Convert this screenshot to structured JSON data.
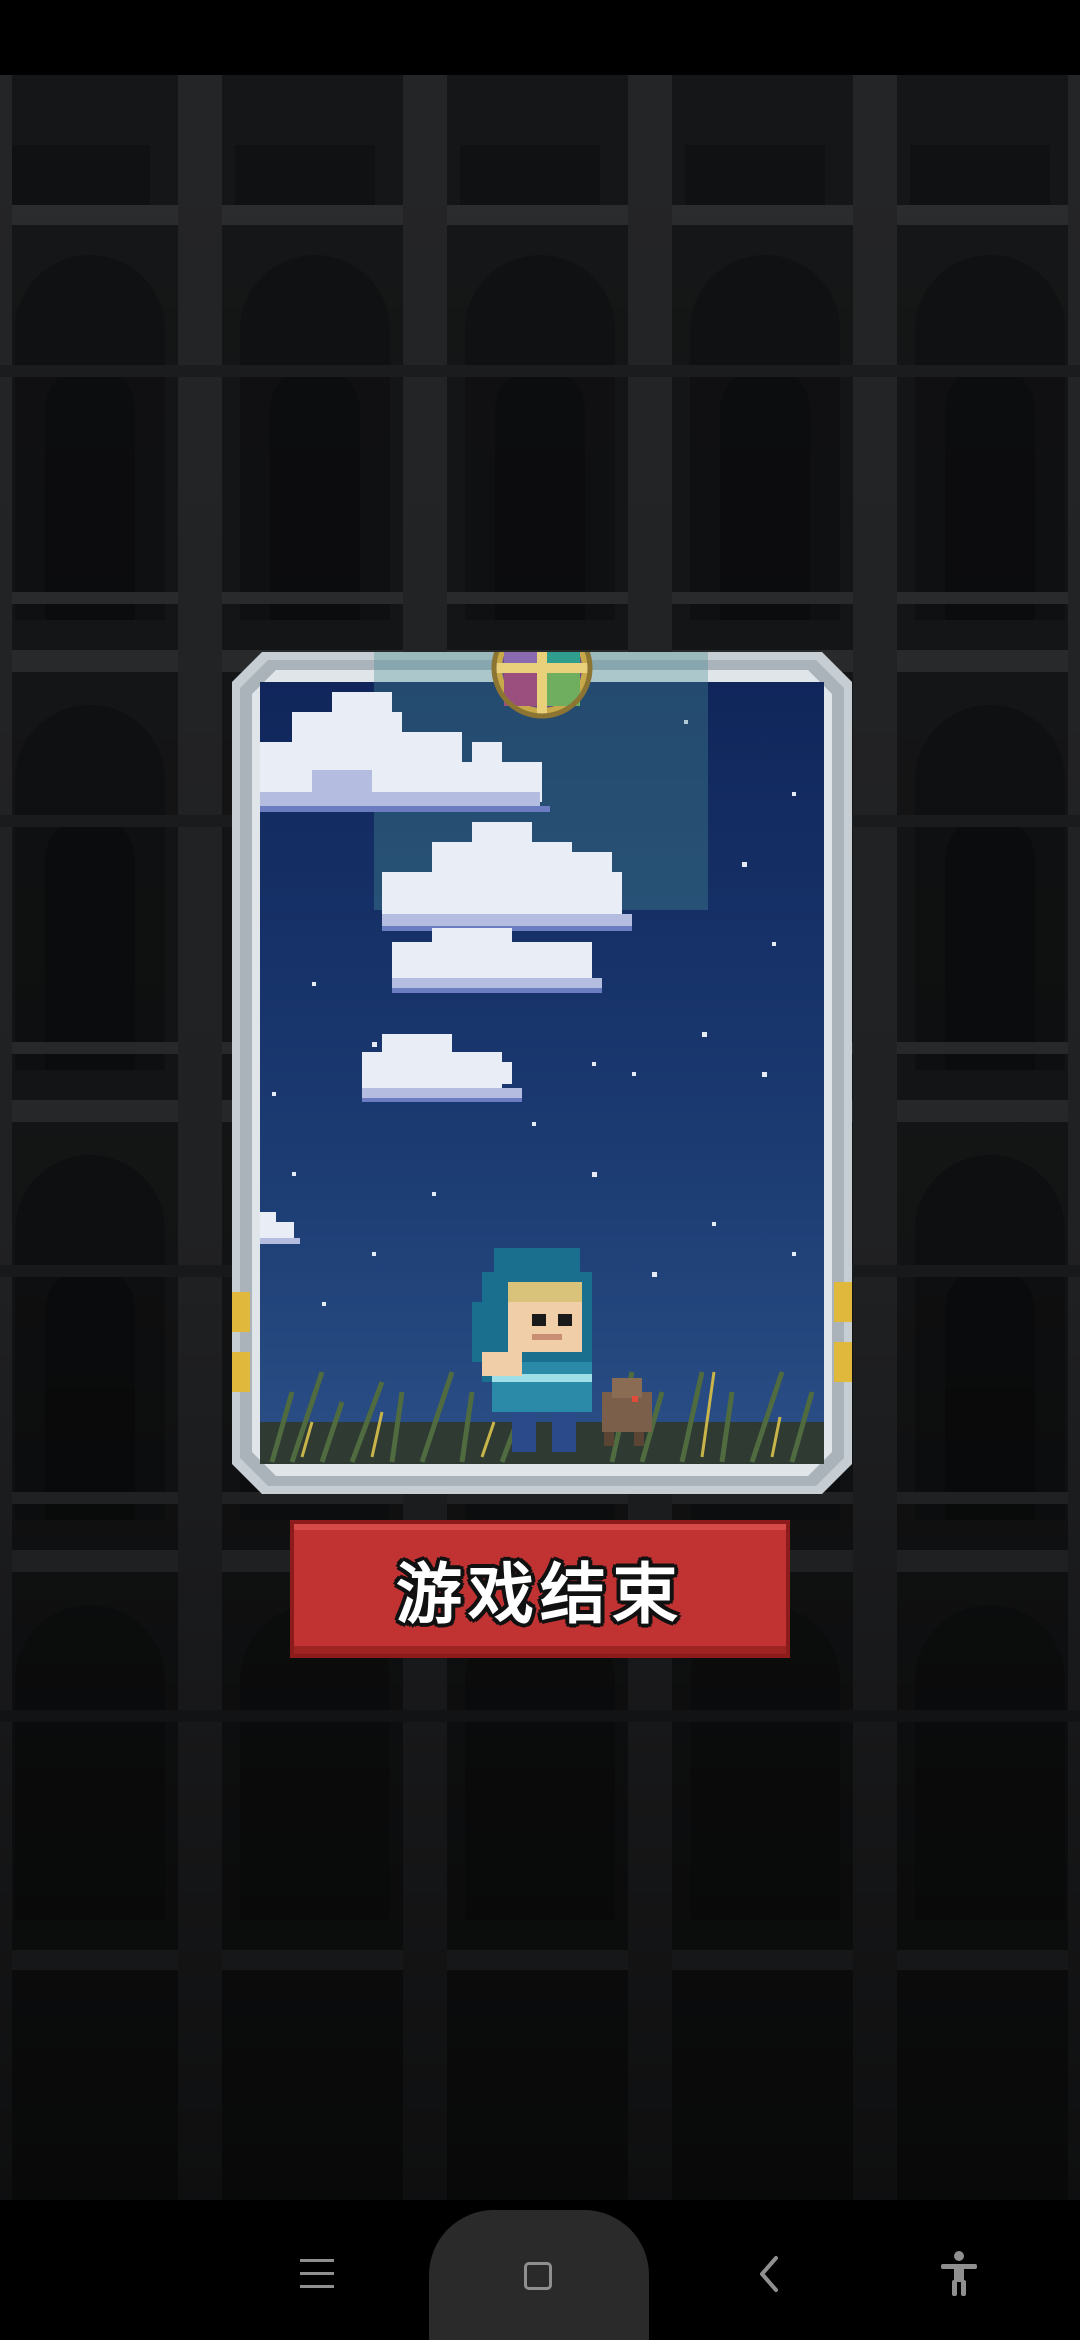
{
  "game": {
    "end_button_label": "游戏结束"
  },
  "colors": {
    "button_red": "#c13333",
    "card_frame": "#c7ced3",
    "sky_top": "#10265b",
    "sky_bottom": "#2a4f86"
  },
  "icons": {
    "card_top_emblem": "compass-emblem-icon",
    "nav_menu": "menu-icon",
    "nav_home": "home-icon",
    "nav_back": "back-icon",
    "nav_accessibility": "accessibility-icon"
  }
}
